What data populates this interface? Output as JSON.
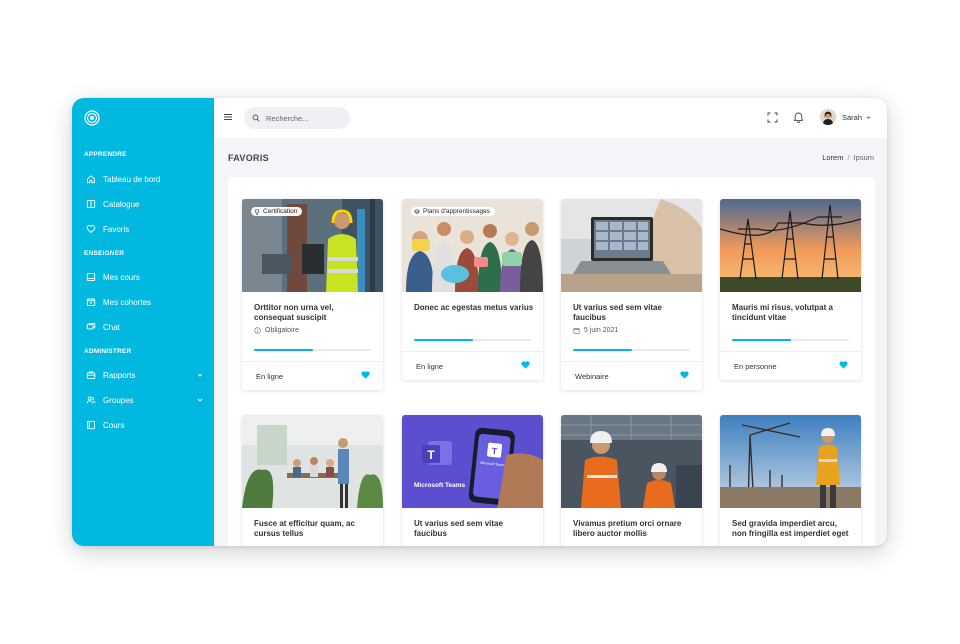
{
  "sidebar": {
    "sections": [
      {
        "title": "APPRENDRE",
        "items": [
          {
            "label": "Tableau de bord",
            "icon": "home-icon"
          },
          {
            "label": "Catalogue",
            "icon": "book-icon"
          },
          {
            "label": "Favoris",
            "icon": "heart-icon"
          }
        ]
      },
      {
        "title": "ENSEIGNER",
        "items": [
          {
            "label": "Mes cours",
            "icon": "monitor-icon"
          },
          {
            "label": "Mes cohortes",
            "icon": "calendar-user-icon"
          },
          {
            "label": "Chat",
            "icon": "chat-icon"
          }
        ]
      },
      {
        "title": "ADMINISTRER",
        "items": [
          {
            "label": "Rapports",
            "icon": "briefcase-icon"
          },
          {
            "label": "Groupes",
            "icon": "users-icon"
          },
          {
            "label": "Cours",
            "icon": "book-open-icon"
          }
        ]
      }
    ]
  },
  "topbar": {
    "search_placeholder": "Recherche...",
    "user_name": "Sarah"
  },
  "page": {
    "title": "FAVORIS",
    "breadcrumb": [
      "Lorem",
      "Ipsum"
    ]
  },
  "cards": [
    {
      "title": "Orttitor non urna vel, consequat suscipit",
      "badge": "Certification",
      "meta": "Obligatoire",
      "meta_icon": "info-icon",
      "progress": 0.5,
      "type": "En ligne"
    },
    {
      "title": "Donec ac egestas metus varius",
      "badge": "Plans d'apprentissages",
      "progress": 0.5,
      "type": "En ligne"
    },
    {
      "title": "Ut varius sed sem vitae faucibus",
      "meta": "5 juin 2021",
      "meta_icon": "calendar-icon",
      "progress": 0.5,
      "type": "Webinaire"
    },
    {
      "title": "Mauris mi risus, volutpat a tincidunt vitae",
      "progress": 0.5,
      "type": "En personne"
    },
    {
      "title": "Fusce at efficitur quam, ac cursus tellus"
    },
    {
      "title": "Ut varius sed sem vitae faucibus"
    },
    {
      "title": "Vivamus pretium orci ornare libero auctor mollis"
    },
    {
      "title": "Sed gravida imperdiet arcu, non fringilla est imperdiet eget"
    }
  ],
  "thumb_texts": {
    "teams_logo": "Microsoft Teams",
    "teams_screen": "Microsoft Teams"
  },
  "colors": {
    "accent": "#00b8e0",
    "sidebar": "#00b8e0",
    "teams": "#5b4fd0"
  }
}
